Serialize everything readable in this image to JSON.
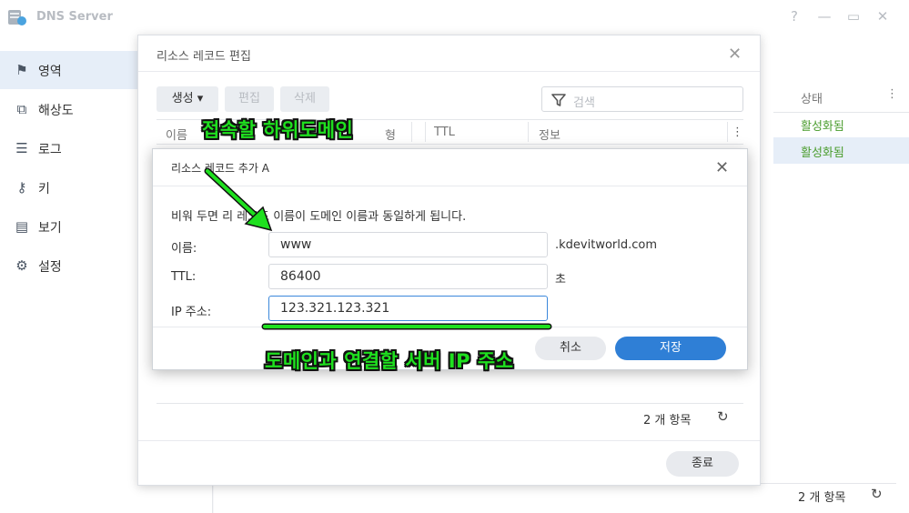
{
  "app": {
    "title": "DNS Server"
  },
  "window_controls": {
    "help": "?",
    "minimize": "—",
    "maximize": "▭",
    "close": "✕"
  },
  "sidebar": {
    "items": [
      {
        "label": "영역",
        "icon": "flag-icon",
        "active": true
      },
      {
        "label": "해상도",
        "icon": "resolution-icon",
        "active": false
      },
      {
        "label": "로그",
        "icon": "list-icon",
        "active": false
      },
      {
        "label": "키",
        "icon": "key-icon",
        "active": false
      },
      {
        "label": "보기",
        "icon": "book-icon",
        "active": false
      },
      {
        "label": "설정",
        "icon": "gear-icon",
        "active": false
      }
    ]
  },
  "background_table": {
    "status_header": "상태",
    "rows": [
      {
        "status": "활성화됨"
      },
      {
        "status": "활성화됨"
      }
    ],
    "count": "2 개 항목"
  },
  "editor": {
    "title": "리소스 레코드 편집",
    "toolbar": {
      "create": "생성 ▾",
      "edit": "편집",
      "delete": "삭제"
    },
    "search_placeholder": "검색",
    "columns": [
      "이름",
      "형",
      "TTL",
      "정보"
    ],
    "count": "2 개 항목",
    "close_button": "종료"
  },
  "dialog": {
    "title": "리소스 레코드 추가 A",
    "description": "비워 두면 리      레코드 이름이 도메인 이름과 동일하게 됩니다.",
    "fields": {
      "name": {
        "label": "이름:",
        "value": "www",
        "suffix": ".kdevitworld.com"
      },
      "ttl": {
        "label": "TTL:",
        "value": "86400",
        "suffix": "초"
      },
      "ip": {
        "label": "IP 주소:",
        "value": "123.321.123.321"
      }
    },
    "cancel": "취소",
    "save": "저장"
  },
  "annotations": {
    "top": "접속할 하위도메인",
    "bottom": "도메인과 연결할 서버 IP 주소",
    "color": "#1fe01f"
  }
}
